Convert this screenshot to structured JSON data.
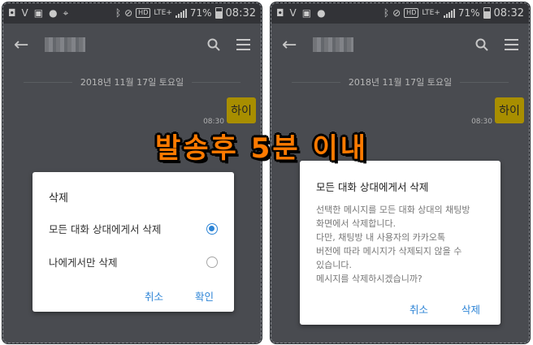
{
  "status_bar": {
    "battery": "71%",
    "time": "08:32",
    "lte": "LTE+",
    "hd": "HD"
  },
  "chat": {
    "date": "2018년 11월 17일 토요일",
    "message": "하이",
    "message_time": "08:30"
  },
  "left_dialog": {
    "title": "삭제",
    "options": [
      {
        "label": "모든 대화 상대에게서 삭제",
        "selected": true
      },
      {
        "label": "나에게서만 삭제",
        "selected": false
      }
    ],
    "cancel": "취소",
    "confirm": "확인"
  },
  "right_dialog": {
    "title": "모든 대화 상대에게서 삭제",
    "body_lines": [
      "선택한 메시지를 모든 대화 상대의 채팅방",
      "화면에서 삭제합니다.",
      "다만, 채팅방 내 사용자의 카카오톡",
      "버전에 따라 메시지가 삭제되지 않을 수",
      "있습니다.",
      "메시지를 삭제하시겠습니까?"
    ],
    "cancel": "취소",
    "delete": "삭제"
  },
  "overlay_caption": "발송후 5분 이내",
  "colors": {
    "accent": "#2d84d6",
    "bubble": "#c6a700",
    "chat_bg": "#56595f",
    "caption": "#ff7a00"
  }
}
